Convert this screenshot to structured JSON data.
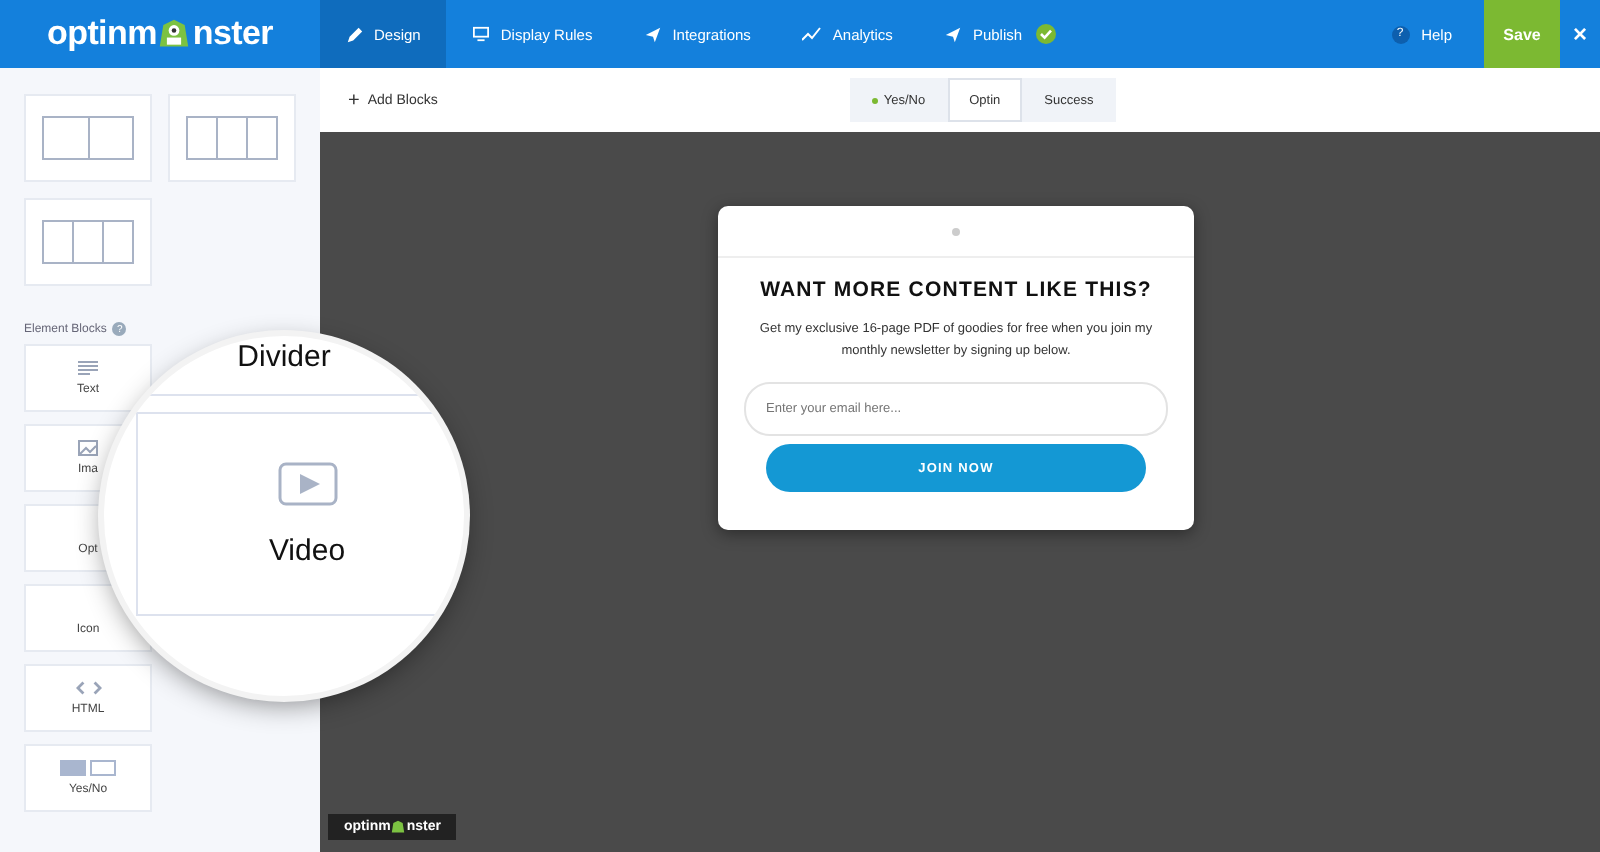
{
  "logo": {
    "before": "optinm",
    "after": "nster"
  },
  "nav": [
    {
      "label": "Design",
      "kind": "pencil",
      "selected": true
    },
    {
      "label": "Display Rules",
      "kind": "monitor",
      "selected": false
    },
    {
      "label": "Integrations",
      "kind": "plane",
      "selected": false
    },
    {
      "label": "Analytics",
      "kind": "chart",
      "selected": false
    },
    {
      "label": "Publish",
      "kind": "plane",
      "selected": false,
      "done": true
    }
  ],
  "help": {
    "icon": "?",
    "label": "Help"
  },
  "save": "Save",
  "close": "×",
  "add_blocks": {
    "icon": "+",
    "label": "Add Blocks"
  },
  "view_tabs": [
    {
      "label": "Yes/No",
      "selected": false,
      "color": "#7cb932"
    },
    {
      "label": "Optin",
      "selected": true
    },
    {
      "label": "Success",
      "selected": false
    }
  ],
  "layout_blocks": [
    {
      "kind": "two_column"
    },
    {
      "kind": "three_column"
    },
    {
      "kind": "three_column"
    }
  ],
  "element_blocks_title": "Element Blocks",
  "element_blocks_help": "?",
  "element_blocks": [
    {
      "label": "Text",
      "kind": "text"
    },
    {
      "label": "Ima",
      "kind": "image"
    },
    {
      "label": "Opt",
      "kind": "plain"
    },
    {
      "label": "Icon",
      "kind": "plain"
    },
    {
      "label": "HTML",
      "kind": "code"
    },
    {
      "label": "Yes/No",
      "kind": "toggle"
    }
  ],
  "magnifier": {
    "top_label": "Divider",
    "label": "Video"
  },
  "popup": {
    "title": "WANT MORE CONTENT LIKE THIS?",
    "text": "Get my exclusive 16-page PDF of goodies for free when you join my monthly newsletter by signing up below.",
    "placeholder": "Enter your email here...",
    "button": "JOIN NOW"
  },
  "footer_logo": {
    "before": "optinm",
    "after": "nster"
  }
}
